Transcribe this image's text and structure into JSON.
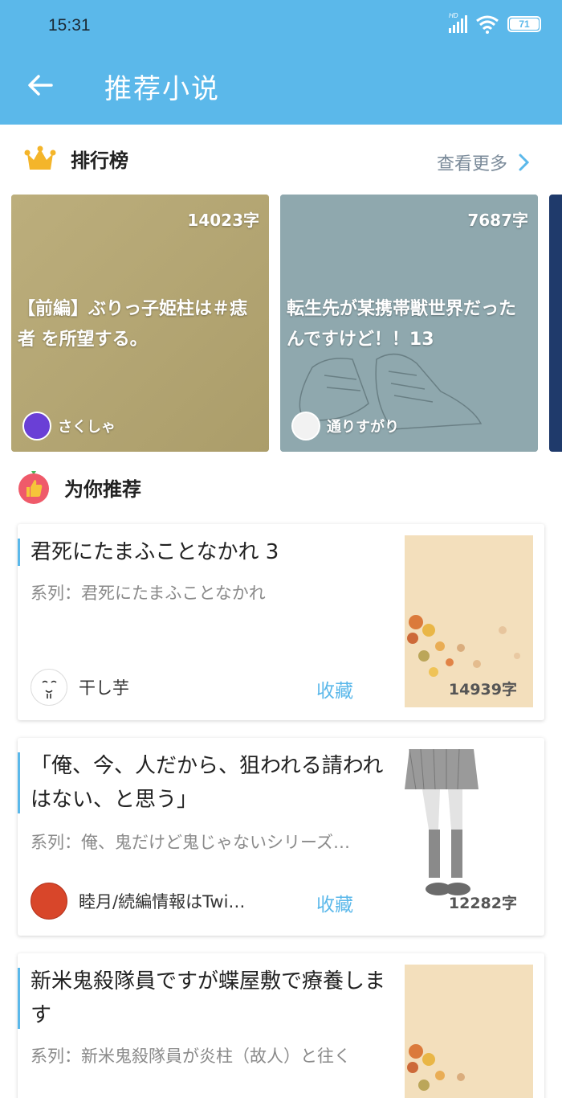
{
  "status_bar": {
    "time": "15:31",
    "battery": "71",
    "signal": "HD"
  },
  "header": {
    "title": "推荐小说"
  },
  "ranking": {
    "title": "排行榜",
    "more_label": "查看更多",
    "cards": [
      {
        "word_count": "14023字",
        "title": "【前編】ぶりっ子姫柱は＃痣者 を所望する。",
        "author": "さくしゃ",
        "bg": "#b5a775"
      },
      {
        "word_count": "7687字",
        "title": "転生先が某携帯獣世界だったんですけど！！13",
        "author": "通りすがり",
        "bg": "#8fa8ae"
      }
    ]
  },
  "recommend": {
    "title": "为你推荐",
    "items": [
      {
        "title": "君死にたまふことなかれ 3",
        "series": "系列：君死にたまふことなかれ",
        "author": "干し芋",
        "fav_label": "收藏",
        "word_count": "14939字"
      },
      {
        "title": "「俺、今、人だから、狙われる請われはない、と思う」",
        "series": "系列：俺、鬼だけど鬼じゃないシリーズ…",
        "author": "睦月/続編情報はTwi…",
        "fav_label": "收藏",
        "word_count": "12282字"
      },
      {
        "title": "新米鬼殺隊員ですが蝶屋敷で療養します",
        "series": "系列：新米鬼殺隊員が炎柱（故人）と往く",
        "author": "",
        "fav_label": "",
        "word_count": ""
      }
    ]
  },
  "colors": {
    "header_bg": "#5bb8ea",
    "accent": "#5bb8ea",
    "crown": "#f4b52a",
    "thumb_badge": "#ef5a6a"
  }
}
